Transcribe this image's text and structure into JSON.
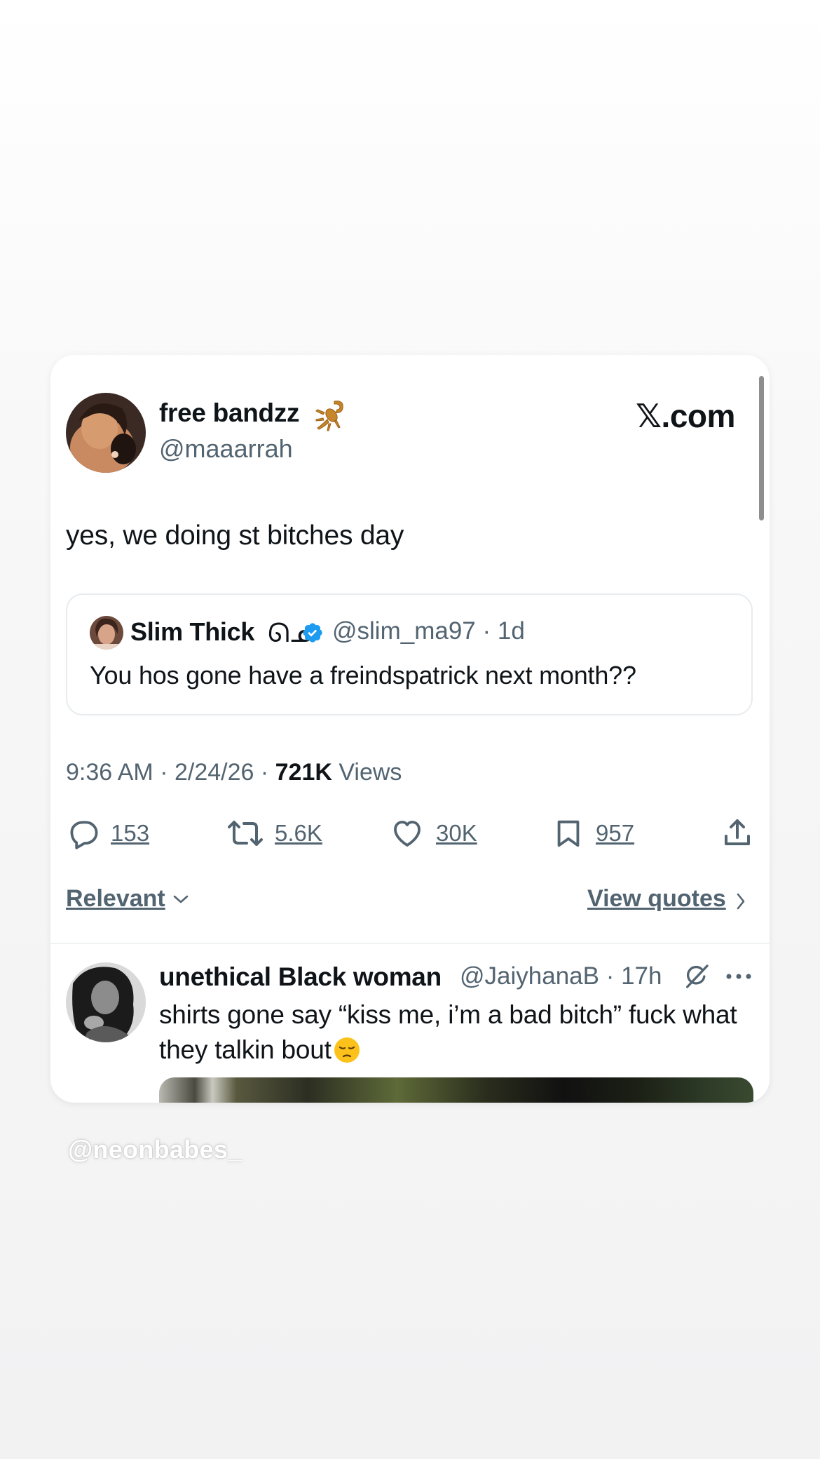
{
  "tweet": {
    "author_name": "free bandzz",
    "author_emoji": "scorpion-icon",
    "author_handle": "@maaarrah",
    "site_logo": "𝕏.com",
    "text": "yes, we doing st bitches day",
    "quoted": {
      "name": "Slim Thick",
      "name_glyph": "ᘏᓄ",
      "verified": true,
      "handle_time": "@slim_ma97 · 1d",
      "text": "You hos gone have a freindspatrick next month??"
    },
    "meta": {
      "time_date": "9:36 AM · 2/24/26 · ",
      "views_count": "721K",
      "views_label": " Views"
    },
    "actions": [
      {
        "icon": "reply-icon",
        "count": "153"
      },
      {
        "icon": "retweet-icon",
        "count": "5.6K"
      },
      {
        "icon": "like-icon",
        "count": "30K"
      },
      {
        "icon": "bookmark-icon",
        "count": "957"
      },
      {
        "icon": "share-icon",
        "count": ""
      }
    ],
    "sort_label": "Relevant",
    "view_quotes_label": "View quotes"
  },
  "reply": {
    "name": "unethical Black woman",
    "handle_time": "@JaiyhanaB · 17h",
    "text": "shirts gone say “kiss me, i’m a bad bitch” fuck what they talkin bout",
    "emoji": "pensive-face-icon"
  },
  "watermark": "@neonbabes_",
  "colors": {
    "secondary_text": "#536471",
    "verified_blue": "#1d9bf0",
    "primary_text": "#0f1419"
  }
}
